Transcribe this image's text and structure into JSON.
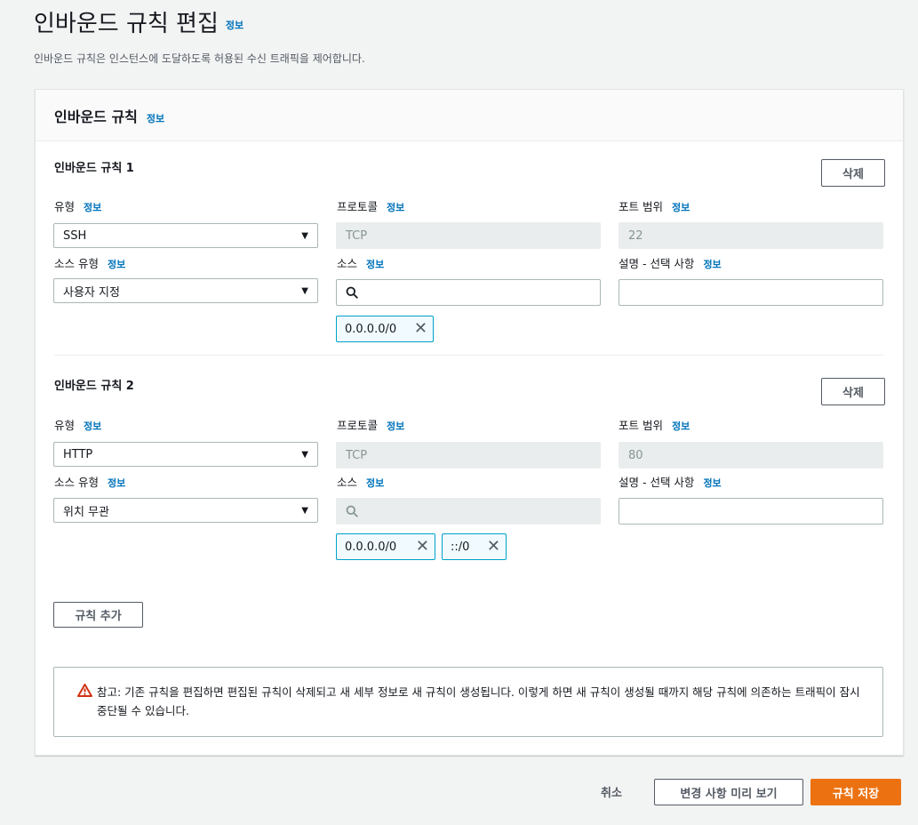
{
  "page": {
    "title": "인바운드 규칙 편집",
    "title_info": "정보",
    "subtitle": "인바운드 규칙은 인스턴스에 도달하도록 허용된 수신 트래픽을 제어합니다."
  },
  "panel": {
    "title": "인바운드 규칙",
    "info": "정보"
  },
  "labels": {
    "type": "유형",
    "protocol": "프로토콜",
    "port_range": "포트 범위",
    "source_type": "소스 유형",
    "source": "소스",
    "description": "설명 - 선택 사항",
    "info": "정보",
    "delete": "삭제"
  },
  "rules": [
    {
      "title": "인바운드 규칙 1",
      "type": "SSH",
      "protocol": "TCP",
      "port_range": "22",
      "source_type": "사용자 지정",
      "source_search_disabled": false,
      "sources": [
        "0.0.0.0/0"
      ],
      "description": ""
    },
    {
      "title": "인바운드 규칙 2",
      "type": "HTTP",
      "protocol": "TCP",
      "port_range": "80",
      "source_type": "위치 무관",
      "source_search_disabled": true,
      "sources": [
        "0.0.0.0/0",
        "::/0"
      ],
      "description": ""
    }
  ],
  "add_rule_button": "규칙 추가",
  "note": "참고: 기존 규칙을 편집하면 편집된 규칙이 삭제되고 새 세부 정보로 새 규칙이 생성됩니다. 이렇게 하면 새 규칙이 생성될 때까지 해당 규칙에 의존하는 트래픽이 잠시 중단될 수 있습니다.",
  "footer": {
    "cancel": "취소",
    "preview": "변경 사항 미리 보기",
    "save": "규칙 저장"
  },
  "colors": {
    "accent_link": "#0073bb",
    "primary_button": "#ec7211",
    "warning_icon": "#d13212",
    "token_border": "#00a1c9"
  }
}
